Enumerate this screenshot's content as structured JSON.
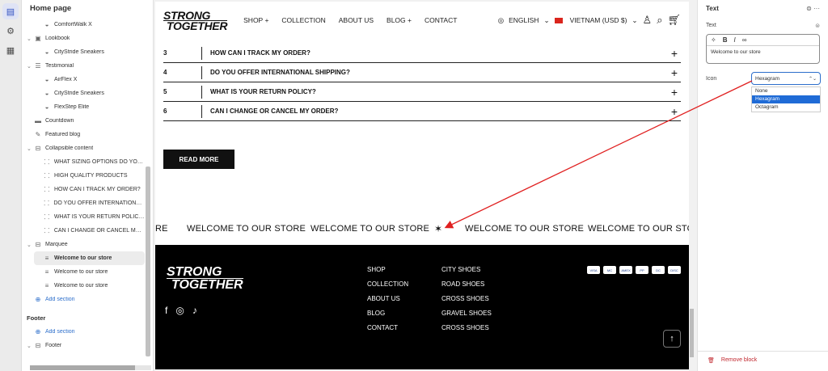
{
  "sidebar": {
    "title": "Home page",
    "items": [
      {
        "label": "ComfortWalk X",
        "icon": "shoe-icon",
        "level": 2
      },
      {
        "label": "Lookbook",
        "icon": "image-icon",
        "level": 1,
        "chev": "v"
      },
      {
        "label": "CityStride Sneakers",
        "icon": "shoe-icon",
        "level": 2
      },
      {
        "label": "Testimonial",
        "icon": "list-icon",
        "level": 1,
        "chev": "v"
      },
      {
        "label": "AirFlex X",
        "icon": "shoe-icon",
        "level": 2
      },
      {
        "label": "CityStride Sneakers",
        "icon": "shoe-icon",
        "level": 2
      },
      {
        "label": "FlexStep Elite",
        "icon": "shoe-icon",
        "level": 2
      },
      {
        "label": "Countdown",
        "icon": "countdown-icon",
        "level": 1
      },
      {
        "label": "Featured blog",
        "icon": "blog-icon",
        "level": 1
      },
      {
        "label": "Collapsible content",
        "icon": "collapsible-icon",
        "level": 1,
        "chev": "v"
      },
      {
        "label": "WHAT SIZING OPTIONS DO YOU...",
        "icon": "block-icon",
        "level": 2
      },
      {
        "label": "HIGH QUALITY PRODUCTS",
        "icon": "block-icon",
        "level": 2
      },
      {
        "label": "HOW CAN I TRACK MY ORDER?",
        "icon": "block-icon",
        "level": 2
      },
      {
        "label": "DO YOU OFFER INTERNATIONAL...",
        "icon": "block-icon",
        "level": 2
      },
      {
        "label": "WHAT IS YOUR RETURN POLICY?",
        "icon": "block-icon",
        "level": 2
      },
      {
        "label": "CAN I CHANGE OR CANCEL MY ...",
        "icon": "block-icon",
        "level": 2
      },
      {
        "label": "Marquee",
        "icon": "marquee-icon",
        "level": 1,
        "chev": "v"
      },
      {
        "label": "Welcome to our store",
        "icon": "text-icon",
        "level": 2,
        "selected": true
      },
      {
        "label": "Welcome to our store",
        "icon": "text-icon",
        "level": 2
      },
      {
        "label": "Welcome to our store",
        "icon": "text-icon",
        "level": 2
      },
      {
        "label": "Add section",
        "icon": "plus-icon",
        "level": 1,
        "add": true
      }
    ],
    "footer_title": "Footer",
    "footer_add": "Add section",
    "footer_item": "Footer"
  },
  "store": {
    "logo_line1": "STRONG",
    "logo_line2": "TOGETHER",
    "nav": [
      "SHOP +",
      "COLLECTION",
      "ABOUT US",
      "BLOG +",
      "CONTACT"
    ],
    "language": "ENGLISH",
    "currency": "VIETNAM (USD $)",
    "faq": [
      {
        "num": "3",
        "q": "HOW CAN I TRACK MY ORDER?"
      },
      {
        "num": "4",
        "q": "DO YOU OFFER INTERNATIONAL SHIPPING?"
      },
      {
        "num": "5",
        "q": "WHAT IS YOUR RETURN POLICY?"
      },
      {
        "num": "6",
        "q": "CAN I CHANGE OR CANCEL MY ORDER?"
      }
    ],
    "read_more": "READ MORE",
    "marquee": [
      "RE",
      "WELCOME TO OUR STORE",
      "WELCOME TO OUR STORE",
      "WELCOME TO OUR STORE",
      "WELCOME TO OUR STORE"
    ],
    "marquee_icon": "✶",
    "footer_col1": [
      "SHOP",
      "COLLECTION",
      "ABOUT US",
      "BLOG",
      "CONTACT"
    ],
    "footer_col2": [
      "CITY SHOES",
      "ROAD SHOES",
      "CROSS SHOES",
      "GRAVEL SHOES",
      "CROSS SHOES"
    ],
    "payments": [
      "VISA",
      "MC",
      "AMEX",
      "PP",
      "DC",
      "DISC"
    ]
  },
  "panel": {
    "title": "Text",
    "text_label": "Text",
    "text_value": "Welcome to our store",
    "icon_label": "Icon",
    "icon_selected": "Hexagram",
    "icon_options": [
      "None",
      "Hexagram",
      "Octagram"
    ],
    "remove_label": "Remove block"
  },
  "colors": {
    "accent": "#2c6ecb",
    "danger": "#c0262d",
    "arrow": "#e02020"
  }
}
